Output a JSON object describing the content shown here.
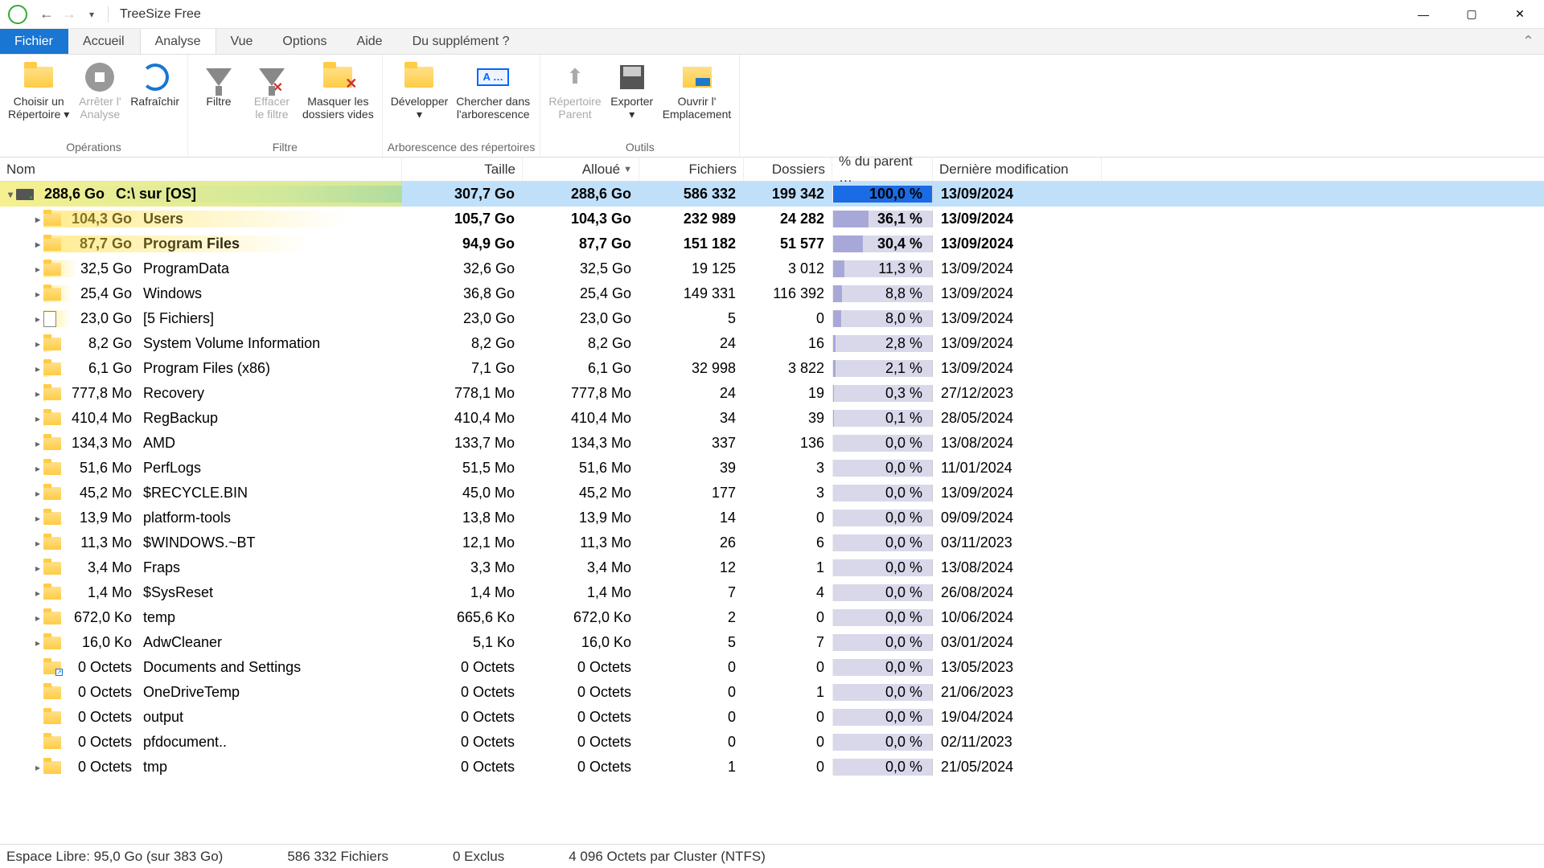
{
  "app": {
    "title": "TreeSize Free"
  },
  "menu": {
    "file": "Fichier",
    "tabs": [
      "Accueil",
      "Analyse",
      "Vue",
      "Options",
      "Aide",
      "Du supplément ?"
    ],
    "activeIndex": 1
  },
  "ribbon": {
    "groups": [
      {
        "label": "Opérations",
        "buttons": [
          {
            "key": "choose-dir",
            "line1": "Choisir un",
            "line2": "Répertoire ▾",
            "icon": "folder"
          },
          {
            "key": "stop",
            "line1": "Arrêter l'",
            "line2": "Analyse",
            "icon": "stop",
            "disabled": true
          },
          {
            "key": "refresh",
            "line1": "Rafraîchir",
            "line2": "",
            "icon": "refresh"
          }
        ]
      },
      {
        "label": "Filtre",
        "buttons": [
          {
            "key": "filter",
            "line1": "Filtre",
            "line2": "",
            "icon": "funnel"
          },
          {
            "key": "clear-filter",
            "line1": "Effacer",
            "line2": "le filtre",
            "icon": "funnel-x",
            "disabled": true
          },
          {
            "key": "hide-empty",
            "line1": "Masquer les",
            "line2": "dossiers vides",
            "icon": "folder-x"
          }
        ]
      },
      {
        "label": "Arborescence des répertoires",
        "buttons": [
          {
            "key": "expand",
            "line1": "Développer",
            "line2": "▾",
            "icon": "expand"
          },
          {
            "key": "search-tree",
            "line1": "Chercher dans",
            "line2": "l'arborescence",
            "icon": "badge",
            "badge": "A …"
          }
        ]
      },
      {
        "label": "Outils",
        "buttons": [
          {
            "key": "parent",
            "line1": "Répertoire",
            "line2": "Parent",
            "icon": "up",
            "disabled": true
          },
          {
            "key": "export",
            "line1": "Exporter",
            "line2": "▾",
            "icon": "save"
          },
          {
            "key": "open-loc",
            "line1": "Ouvrir l'",
            "line2": "Emplacement",
            "icon": "open"
          }
        ]
      }
    ]
  },
  "columns": {
    "name": "Nom",
    "taille": "Taille",
    "alloue": "Alloué",
    "fichiers": "Fichiers",
    "dossiers": "Dossiers",
    "pct": "% du parent …",
    "date": "Dernière modification"
  },
  "root": {
    "size": "288,6 Go",
    "name": "C:\\  sur   [OS]",
    "taille": "307,7 Go",
    "alloue": "288,6 Go",
    "fichiers": "586 332",
    "dossiers": "199 342",
    "pct": "100,0 %",
    "pctv": 100,
    "date": "13/09/2024",
    "icon": "drive",
    "expanded": true
  },
  "rows": [
    {
      "bold": true,
      "indent": 40,
      "exp": true,
      "icon": "folder",
      "size": "104,3 Go",
      "name": "Users",
      "taille": "105,7 Go",
      "alloue": "104,3 Go",
      "fichiers": "232 989",
      "dossiers": "24 282",
      "pct": "36,1 %",
      "pctv": 36.1,
      "date": "13/09/2024",
      "bar": 380
    },
    {
      "bold": true,
      "indent": 40,
      "exp": true,
      "icon": "folder",
      "size": "87,7 Go",
      "name": "Program Files",
      "taille": "94,9 Go",
      "alloue": "87,7 Go",
      "fichiers": "151 182",
      "dossiers": "51 577",
      "pct": "30,4 %",
      "pctv": 30.4,
      "date": "13/09/2024",
      "bar": 330
    },
    {
      "indent": 40,
      "exp": true,
      "icon": "folder",
      "size": "32,5 Go",
      "name": "ProgramData",
      "taille": "32,6 Go",
      "alloue": "32,5 Go",
      "fichiers": "19 125",
      "dossiers": "3 012",
      "pct": "11,3 %",
      "pctv": 11.3,
      "date": "13/09/2024",
      "bar": 42
    },
    {
      "indent": 40,
      "exp": true,
      "icon": "folder",
      "size": "25,4 Go",
      "name": "Windows",
      "taille": "36,8 Go",
      "alloue": "25,4 Go",
      "fichiers": "149 331",
      "dossiers": "116 392",
      "pct": "8,8 %",
      "pctv": 8.8,
      "date": "13/09/2024",
      "bar": 36
    },
    {
      "indent": 40,
      "exp": true,
      "icon": "file",
      "size": "23,0 Go",
      "name": "[5 Fichiers]",
      "taille": "23,0 Go",
      "alloue": "23,0 Go",
      "fichiers": "5",
      "dossiers": "0",
      "pct": "8,0 %",
      "pctv": 8.0,
      "date": "13/09/2024",
      "bar": 34
    },
    {
      "indent": 40,
      "exp": true,
      "icon": "folder",
      "size": "8,2 Go",
      "name": "System Volume Information",
      "taille": "8,2 Go",
      "alloue": "8,2 Go",
      "fichiers": "24",
      "dossiers": "16",
      "pct": "2,8 %",
      "pctv": 2.8,
      "date": "13/09/2024",
      "bar": 16
    },
    {
      "indent": 40,
      "exp": true,
      "icon": "folder",
      "size": "6,1 Go",
      "name": "Program Files (x86)",
      "taille": "7,1 Go",
      "alloue": "6,1 Go",
      "fichiers": "32 998",
      "dossiers": "3 822",
      "pct": "2,1 %",
      "pctv": 2.1,
      "date": "13/09/2024",
      "bar": 12
    },
    {
      "indent": 40,
      "exp": true,
      "icon": "folder",
      "size": "777,8 Mo",
      "name": "Recovery",
      "taille": "778,1 Mo",
      "alloue": "777,8 Mo",
      "fichiers": "24",
      "dossiers": "19",
      "pct": "0,3 %",
      "pctv": 0.3,
      "date": "27/12/2023",
      "bar": 4
    },
    {
      "indent": 40,
      "exp": true,
      "icon": "folder",
      "size": "410,4 Mo",
      "name": "RegBackup",
      "taille": "410,4 Mo",
      "alloue": "410,4 Mo",
      "fichiers": "34",
      "dossiers": "39",
      "pct": "0,1 %",
      "pctv": 0.1,
      "date": "28/05/2024",
      "bar": 2
    },
    {
      "indent": 40,
      "exp": true,
      "icon": "folder",
      "size": "134,3 Mo",
      "name": "AMD",
      "taille": "133,7 Mo",
      "alloue": "134,3 Mo",
      "fichiers": "337",
      "dossiers": "136",
      "pct": "0,0 %",
      "pctv": 0,
      "date": "13/08/2024",
      "bar": 0
    },
    {
      "indent": 40,
      "exp": true,
      "icon": "folder",
      "size": "51,6 Mo",
      "name": "PerfLogs",
      "taille": "51,5 Mo",
      "alloue": "51,6 Mo",
      "fichiers": "39",
      "dossiers": "3",
      "pct": "0,0 %",
      "pctv": 0,
      "date": "11/01/2024",
      "bar": 0
    },
    {
      "indent": 40,
      "exp": true,
      "icon": "folder",
      "size": "45,2 Mo",
      "name": "$RECYCLE.BIN",
      "taille": "45,0 Mo",
      "alloue": "45,2 Mo",
      "fichiers": "177",
      "dossiers": "3",
      "pct": "0,0 %",
      "pctv": 0,
      "date": "13/09/2024",
      "bar": 0
    },
    {
      "indent": 40,
      "exp": true,
      "icon": "folder",
      "size": "13,9 Mo",
      "name": "platform-tools",
      "taille": "13,8 Mo",
      "alloue": "13,9 Mo",
      "fichiers": "14",
      "dossiers": "0",
      "pct": "0,0 %",
      "pctv": 0,
      "date": "09/09/2024",
      "bar": 0
    },
    {
      "indent": 40,
      "exp": true,
      "icon": "folder",
      "size": "11,3 Mo",
      "name": "$WINDOWS.~BT",
      "taille": "12,1 Mo",
      "alloue": "11,3 Mo",
      "fichiers": "26",
      "dossiers": "6",
      "pct": "0,0 %",
      "pctv": 0,
      "date": "03/11/2023",
      "bar": 0
    },
    {
      "indent": 40,
      "exp": true,
      "icon": "folder",
      "size": "3,4 Mo",
      "name": "Fraps",
      "taille": "3,3 Mo",
      "alloue": "3,4 Mo",
      "fichiers": "12",
      "dossiers": "1",
      "pct": "0,0 %",
      "pctv": 0,
      "date": "13/08/2024",
      "bar": 0
    },
    {
      "indent": 40,
      "exp": true,
      "icon": "folder",
      "size": "1,4 Mo",
      "name": "$SysReset",
      "taille": "1,4 Mo",
      "alloue": "1,4 Mo",
      "fichiers": "7",
      "dossiers": "4",
      "pct": "0,0 %",
      "pctv": 0,
      "date": "26/08/2024",
      "bar": 0
    },
    {
      "indent": 40,
      "exp": true,
      "icon": "folder",
      "size": "672,0 Ko",
      "name": "temp",
      "taille": "665,6 Ko",
      "alloue": "672,0 Ko",
      "fichiers": "2",
      "dossiers": "0",
      "pct": "0,0 %",
      "pctv": 0,
      "date": "10/06/2024",
      "bar": 0
    },
    {
      "indent": 40,
      "exp": true,
      "icon": "folder",
      "size": "16,0 Ko",
      "name": "AdwCleaner",
      "taille": "5,1 Ko",
      "alloue": "16,0 Ko",
      "fichiers": "5",
      "dossiers": "7",
      "pct": "0,0 %",
      "pctv": 0,
      "date": "03/01/2024",
      "bar": 0
    },
    {
      "indent": 40,
      "exp": false,
      "icon": "folder-link",
      "size": "0 Octets",
      "name": "Documents and Settings",
      "taille": "0 Octets",
      "alloue": "0 Octets",
      "fichiers": "0",
      "dossiers": "0",
      "pct": "0,0 %",
      "pctv": 0,
      "date": "13/05/2023",
      "bar": 0
    },
    {
      "indent": 40,
      "exp": false,
      "icon": "folder",
      "size": "0 Octets",
      "name": "OneDriveTemp",
      "taille": "0 Octets",
      "alloue": "0 Octets",
      "fichiers": "0",
      "dossiers": "1",
      "pct": "0,0 %",
      "pctv": 0,
      "date": "21/06/2023",
      "bar": 0
    },
    {
      "indent": 40,
      "exp": false,
      "icon": "folder",
      "size": "0 Octets",
      "name": "output",
      "taille": "0 Octets",
      "alloue": "0 Octets",
      "fichiers": "0",
      "dossiers": "0",
      "pct": "0,0 %",
      "pctv": 0,
      "date": "19/04/2024",
      "bar": 0
    },
    {
      "indent": 40,
      "exp": false,
      "icon": "folder",
      "size": "0 Octets",
      "name": "pfdocument..",
      "taille": "0 Octets",
      "alloue": "0 Octets",
      "fichiers": "0",
      "dossiers": "0",
      "pct": "0,0 %",
      "pctv": 0,
      "date": "02/11/2023",
      "bar": 0
    },
    {
      "indent": 40,
      "exp": true,
      "icon": "folder",
      "size": "0 Octets",
      "name": "tmp",
      "taille": "0 Octets",
      "alloue": "0 Octets",
      "fichiers": "1",
      "dossiers": "0",
      "pct": "0,0 %",
      "pctv": 0,
      "date": "21/05/2024",
      "bar": 0
    }
  ],
  "status": {
    "free": "Espace Libre: 95,0 Go  (sur 383 Go)",
    "files": "586 332 Fichiers",
    "excl": "0 Exclus",
    "cluster": "4 096 Octets par Cluster (NTFS)"
  },
  "dropdown_glyph": "▾"
}
